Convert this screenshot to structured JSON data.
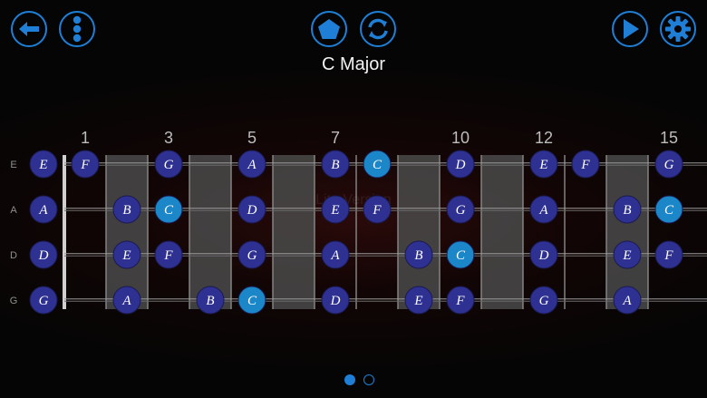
{
  "toolbar": {
    "back": "back-arrow-icon",
    "menu": "menu-dots-icon",
    "shape": "pentagon-icon",
    "refresh": "refresh-icon",
    "play": "play-icon",
    "settings": "gear-icon"
  },
  "title": "C Major",
  "watermark": "Lite Version",
  "fret_numbers": [
    {
      "fret": 1,
      "label": "1"
    },
    {
      "fret": 3,
      "label": "3"
    },
    {
      "fret": 5,
      "label": "5"
    },
    {
      "fret": 7,
      "label": "7"
    },
    {
      "fret": 10,
      "label": "10"
    },
    {
      "fret": 12,
      "label": "12"
    },
    {
      "fret": 15,
      "label": "15"
    }
  ],
  "strings": [
    {
      "name": "E",
      "notes": [
        {
          "fret": 0,
          "note": "E",
          "root": false
        },
        {
          "fret": 1,
          "note": "F",
          "root": false
        },
        {
          "fret": 3,
          "note": "G",
          "root": false
        },
        {
          "fret": 5,
          "note": "A",
          "root": false
        },
        {
          "fret": 7,
          "note": "B",
          "root": false
        },
        {
          "fret": 8,
          "note": "C",
          "root": true
        },
        {
          "fret": 10,
          "note": "D",
          "root": false
        },
        {
          "fret": 12,
          "note": "E",
          "root": false
        },
        {
          "fret": 13,
          "note": "F",
          "root": false
        },
        {
          "fret": 15,
          "note": "G",
          "root": false
        }
      ]
    },
    {
      "name": "A",
      "notes": [
        {
          "fret": 0,
          "note": "A",
          "root": false
        },
        {
          "fret": 2,
          "note": "B",
          "root": false
        },
        {
          "fret": 3,
          "note": "C",
          "root": true
        },
        {
          "fret": 5,
          "note": "D",
          "root": false
        },
        {
          "fret": 7,
          "note": "E",
          "root": false
        },
        {
          "fret": 8,
          "note": "F",
          "root": false
        },
        {
          "fret": 10,
          "note": "G",
          "root": false
        },
        {
          "fret": 12,
          "note": "A",
          "root": false
        },
        {
          "fret": 14,
          "note": "B",
          "root": false
        },
        {
          "fret": 15,
          "note": "C",
          "root": true
        }
      ]
    },
    {
      "name": "D",
      "notes": [
        {
          "fret": 0,
          "note": "D",
          "root": false
        },
        {
          "fret": 2,
          "note": "E",
          "root": false
        },
        {
          "fret": 3,
          "note": "F",
          "root": false
        },
        {
          "fret": 5,
          "note": "G",
          "root": false
        },
        {
          "fret": 7,
          "note": "A",
          "root": false
        },
        {
          "fret": 9,
          "note": "B",
          "root": false
        },
        {
          "fret": 10,
          "note": "C",
          "root": true
        },
        {
          "fret": 12,
          "note": "D",
          "root": false
        },
        {
          "fret": 14,
          "note": "E",
          "root": false
        },
        {
          "fret": 15,
          "note": "F",
          "root": false
        }
      ]
    },
    {
      "name": "G",
      "notes": [
        {
          "fret": 0,
          "note": "G",
          "root": false
        },
        {
          "fret": 2,
          "note": "A",
          "root": false
        },
        {
          "fret": 4,
          "note": "B",
          "root": false
        },
        {
          "fret": 5,
          "note": "C",
          "root": true
        },
        {
          "fret": 7,
          "note": "D",
          "root": false
        },
        {
          "fret": 9,
          "note": "E",
          "root": false
        },
        {
          "fret": 10,
          "note": "F",
          "root": false
        },
        {
          "fret": 12,
          "note": "G",
          "root": false
        },
        {
          "fret": 14,
          "note": "A",
          "root": false
        }
      ]
    }
  ],
  "highlighted_frets": [
    3,
    5,
    7,
    10,
    12,
    15
  ],
  "pager": {
    "pages": 2,
    "current": 1
  },
  "colors": {
    "accent": "#1f7fd6",
    "note_fill": "#2e3191",
    "root_fill": "#1b87c9"
  }
}
